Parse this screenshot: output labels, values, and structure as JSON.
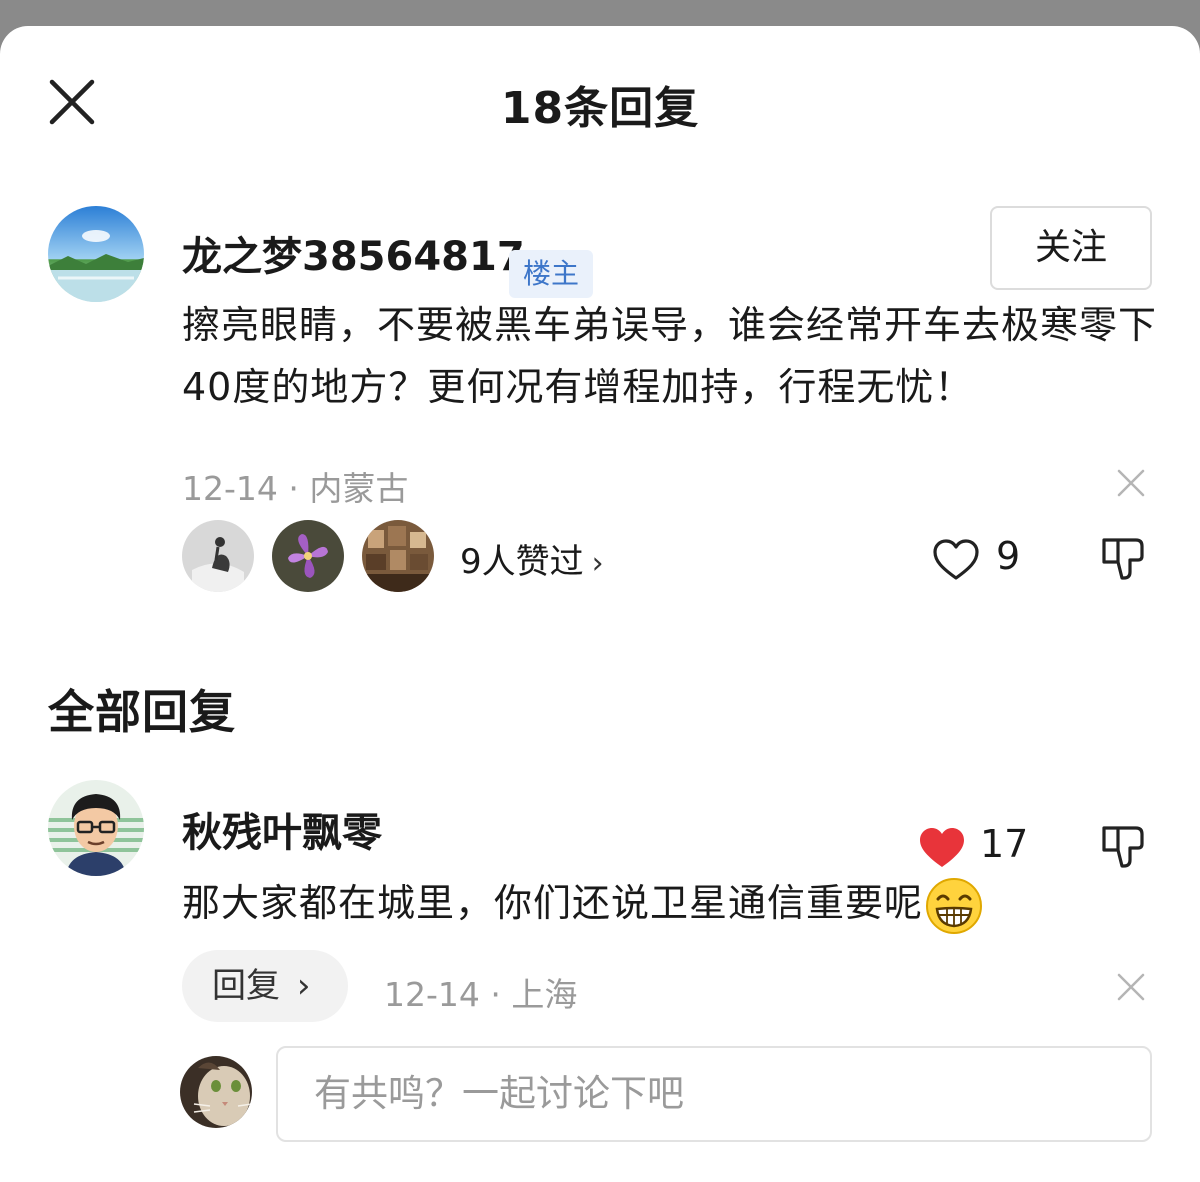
{
  "header": {
    "title": "18条回复"
  },
  "main_comment": {
    "username": "龙之梦38564817",
    "badge": "楼主",
    "follow_label": "关注",
    "text": "擦亮眼睛，不要被黑车弟误导，谁会经常开车去极寒零下40度的地方？更何况有增程加持，行程无忧！",
    "meta": "12-14 · 内蒙古",
    "likers_text": "9人赞过",
    "likers_chevron": "›",
    "like_count": "9",
    "liked": false
  },
  "section": {
    "title": "全部回复"
  },
  "reply": {
    "username": "秋残叶飘零",
    "text": "那大家都在城里，你们还说卫星通信重要呢",
    "like_count": "17",
    "liked": true,
    "reply_label": "回复",
    "reply_chevron": "›",
    "meta": "12-14 · 上海"
  },
  "composer": {
    "placeholder": "有共鸣？一起讨论下吧"
  },
  "colors": {
    "badge_bg": "#eaf1fb",
    "badge_text": "#3d76c9",
    "liked_heart": "#e8343a",
    "meta_gray": "#9a9a9a"
  },
  "icons": [
    "close-icon",
    "heart-outline-icon",
    "heart-filled-icon",
    "thumbs-down-icon",
    "dismiss-icon",
    "chevron-right-icon",
    "grin-emoji-icon"
  ]
}
